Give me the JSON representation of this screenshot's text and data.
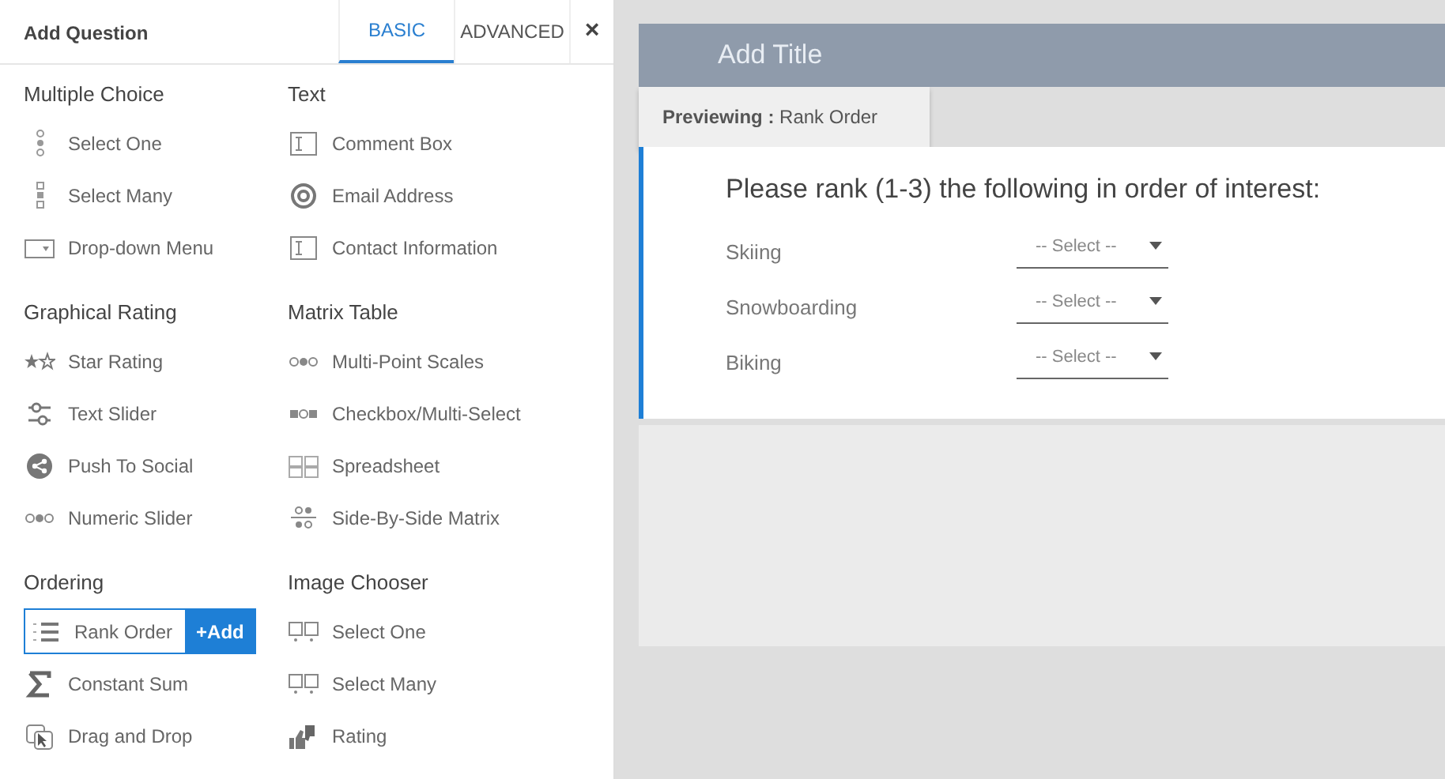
{
  "panel": {
    "title": "Add Question",
    "tabs": [
      {
        "label": "BASIC",
        "selected": true
      },
      {
        "label": "ADVANCED",
        "selected": false
      }
    ],
    "close": "×",
    "add_label": "+Add",
    "sections": [
      {
        "heading": "Multiple Choice",
        "items": [
          {
            "label": "Select One",
            "selected": false
          },
          {
            "label": "Select Many",
            "selected": false
          },
          {
            "label": "Drop-down Menu",
            "selected": false
          }
        ]
      },
      {
        "heading": "Text",
        "items": [
          {
            "label": "Comment Box",
            "selected": false
          },
          {
            "label": "Email Address",
            "selected": false
          },
          {
            "label": "Contact Information",
            "selected": false
          }
        ]
      },
      {
        "heading": "Graphical Rating",
        "items": [
          {
            "label": "Star Rating",
            "selected": false
          },
          {
            "label": "Text Slider",
            "selected": false
          },
          {
            "label": "Push To Social",
            "selected": false
          },
          {
            "label": "Numeric Slider",
            "selected": false
          }
        ]
      },
      {
        "heading": "Matrix Table",
        "items": [
          {
            "label": "Multi-Point Scales",
            "selected": false
          },
          {
            "label": "Checkbox/Multi-Select",
            "selected": false
          },
          {
            "label": "Spreadsheet",
            "selected": false
          },
          {
            "label": "Side-By-Side Matrix",
            "selected": false
          }
        ]
      },
      {
        "heading": "Ordering",
        "items": [
          {
            "label": "Rank Order",
            "selected": true
          },
          {
            "label": "Constant Sum",
            "selected": false
          },
          {
            "label": "Drag and Drop",
            "selected": false
          }
        ]
      },
      {
        "heading": "Image Chooser",
        "items": [
          {
            "label": "Select One",
            "selected": false
          },
          {
            "label": "Select Many",
            "selected": false
          },
          {
            "label": "Rating",
            "selected": false
          }
        ]
      }
    ]
  },
  "preview": {
    "title_placeholder": "Add Title",
    "tab_label": "Previewing :",
    "tab_value": "Rank Order",
    "question": "Please rank (1-3) the following in order of interest:",
    "rows": [
      {
        "label": "Skiing",
        "select": "-- Select --"
      },
      {
        "label": "Snowboarding",
        "select": "-- Select --"
      },
      {
        "label": "Biking",
        "select": "-- Select --"
      }
    ]
  }
}
